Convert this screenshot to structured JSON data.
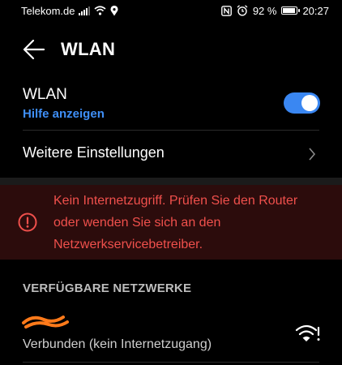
{
  "status_bar": {
    "carrier": "Telekom.de",
    "battery_percent": "92 %",
    "battery_level": 0.92,
    "time": "20:27",
    "icons": [
      "signal-icon",
      "wifi-icon",
      "location-icon",
      "nfc-icon",
      "alarm-icon",
      "battery-icon"
    ]
  },
  "app_bar": {
    "title": "WLAN",
    "back_icon": "arrow-left-icon"
  },
  "wlan_setting": {
    "label": "WLAN",
    "help_link": "Hilfe anzeigen",
    "enabled": true
  },
  "more_settings": {
    "label": "Weitere Einstellungen",
    "icon": "chevron-right-icon"
  },
  "alert": {
    "icon": "exclamation-circle-icon",
    "message": "Kein Internetzugriff. Prüfen Sie den Router oder wenden Sie sich an den Netzwerkservicebetreiber."
  },
  "available_networks": {
    "header": "VERFÜGBARE NETZWERKE",
    "networks": [
      {
        "status": "Verbunden (kein Internetzugang)",
        "icon": "wifi-warning-icon"
      }
    ]
  },
  "colors": {
    "accent": "#3a87f2",
    "link": "#3f8ff7",
    "error_text": "#f0504c",
    "error_bg": "#2c0c0c",
    "scribble": "#ff7a1a"
  }
}
